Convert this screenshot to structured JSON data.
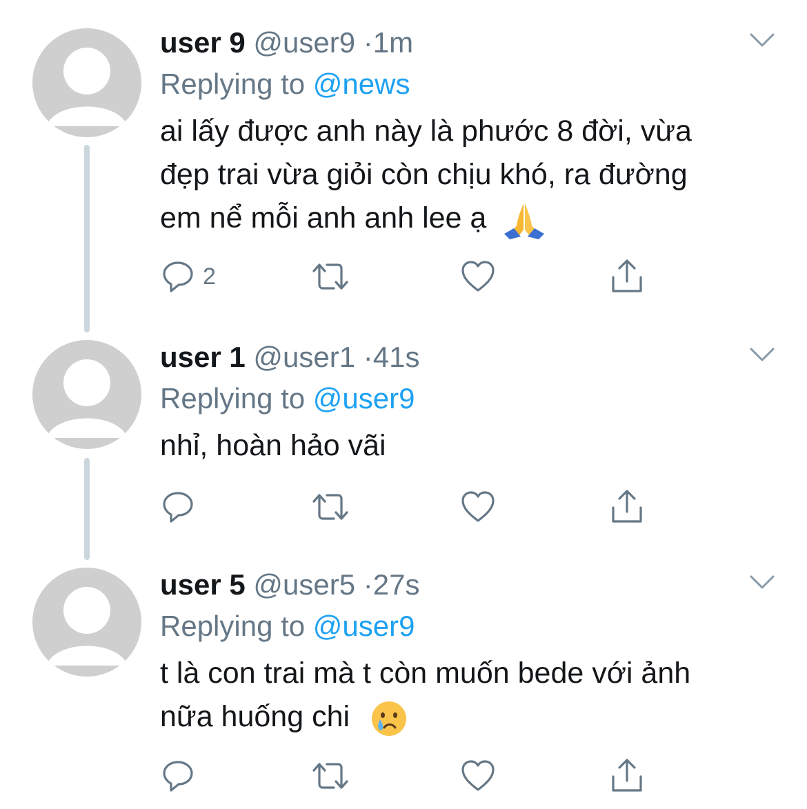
{
  "tweets": [
    {
      "name": "user 9",
      "handle": "@user9",
      "separator": "·",
      "time": "1m",
      "replying_prefix": "Replying to ",
      "replying_to": "@news",
      "lines": [
        "ai lấy được anh này là phước 8 đời, vừa",
        "đẹp trai vừa giỏi còn chịu khó, ra đường",
        "em nể mỗi anh anh lee ạ"
      ],
      "emoji": "folded-hands-emoji",
      "reply_count": "2"
    },
    {
      "name": "user 1",
      "handle": "@user1",
      "separator": "·",
      "time": "41s",
      "replying_prefix": "Replying to ",
      "replying_to": "@user9",
      "lines": [
        "nhỉ, hoàn hảo vãi"
      ],
      "reply_count": ""
    },
    {
      "name": "user 5",
      "handle": "@user5",
      "separator": "·",
      "time": "27s",
      "replying_prefix": "Replying to ",
      "replying_to": "@user9",
      "lines": [
        "t là con trai mà t còn muốn bede với ảnh",
        "nữa huống chi"
      ],
      "emoji": "crying-face-emoji",
      "reply_count": ""
    }
  ],
  "icons": {
    "reply": "reply-icon",
    "retweet": "retweet-icon",
    "like": "heart-icon",
    "share": "share-icon",
    "more": "chevron-down-icon"
  },
  "colors": {
    "link": "#1da1f2",
    "muted": "#657786",
    "text": "#14171a",
    "avatar": "#cfcfcf",
    "thread_line": "#ccd6dd"
  }
}
